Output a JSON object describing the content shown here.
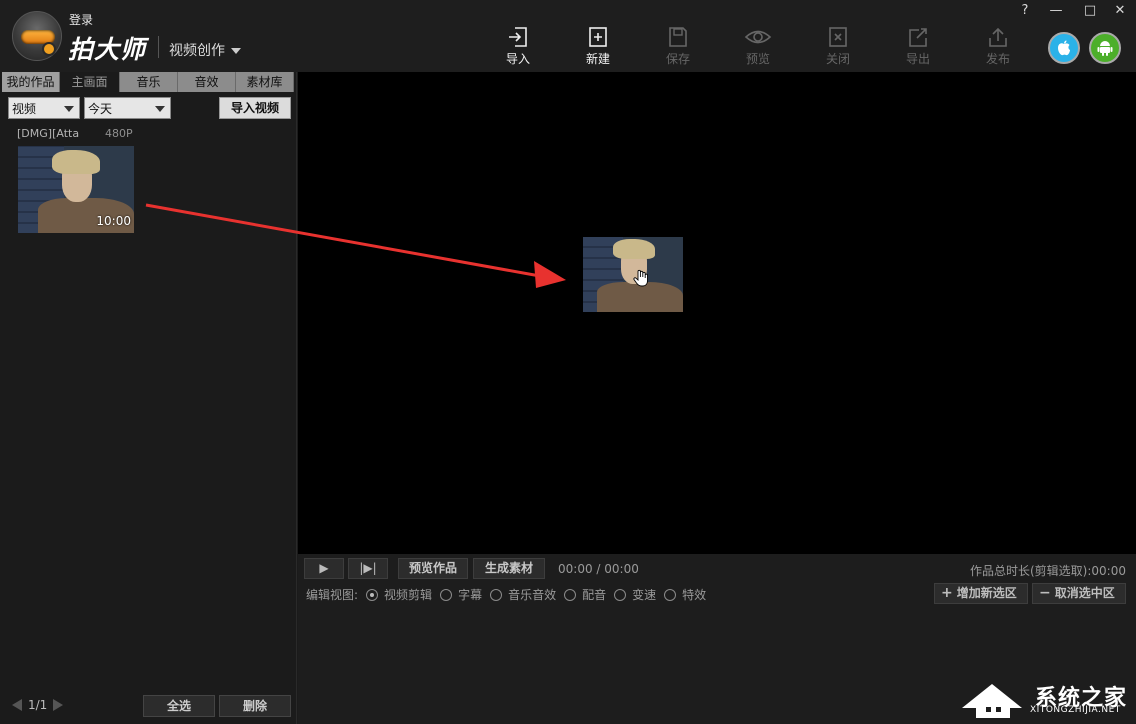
{
  "header": {
    "login": "登录",
    "brand": "拍大师",
    "mode": "视频创作"
  },
  "toolbar": [
    {
      "label": "导入",
      "icon": "import-icon",
      "enabled": true
    },
    {
      "label": "新建",
      "icon": "new-icon",
      "enabled": true
    },
    {
      "label": "保存",
      "icon": "save-icon",
      "enabled": false
    },
    {
      "label": "预览",
      "icon": "preview-eye-icon",
      "enabled": false
    },
    {
      "label": "关闭",
      "icon": "close-file-icon",
      "enabled": false
    },
    {
      "label": "导出",
      "icon": "export-icon",
      "enabled": false
    },
    {
      "label": "发布",
      "icon": "publish-icon",
      "enabled": false
    }
  ],
  "window_controls": {
    "help": "?",
    "minimize": "—",
    "maximize": "□",
    "close": "✕"
  },
  "left_panel": {
    "tabs": [
      "我的作品",
      "主画面",
      "音乐",
      "音效",
      "素材库"
    ],
    "type_select": "视频",
    "date_select": "今天",
    "import_button": "导入视频",
    "clip": {
      "name": "[DMG][Atta",
      "resolution": "480P",
      "duration": "10:00"
    },
    "pager": "1/1",
    "select_all": "全选",
    "delete": "删除"
  },
  "bottom": {
    "play": "▶",
    "step": "|▶|",
    "preview_work": "预览作品",
    "generate": "生成素材",
    "time": "00:00 / 00:00",
    "total": "作品总时长(剪辑选取):00:00",
    "edit_view_label": "编辑视图:",
    "views": [
      "视频剪辑",
      "字幕",
      "音乐音效",
      "配音",
      "变速",
      "特效"
    ],
    "selected_view": 0,
    "add_region": "增加新选区",
    "cancel_region": "取消选中区"
  },
  "watermark": {
    "text": "系统之家",
    "sub": "XITONGZHIJIA.NET"
  },
  "colors": {
    "accent_arrow": "#e8322f",
    "apple": "#2bb2e8",
    "android": "#4caf2a"
  }
}
